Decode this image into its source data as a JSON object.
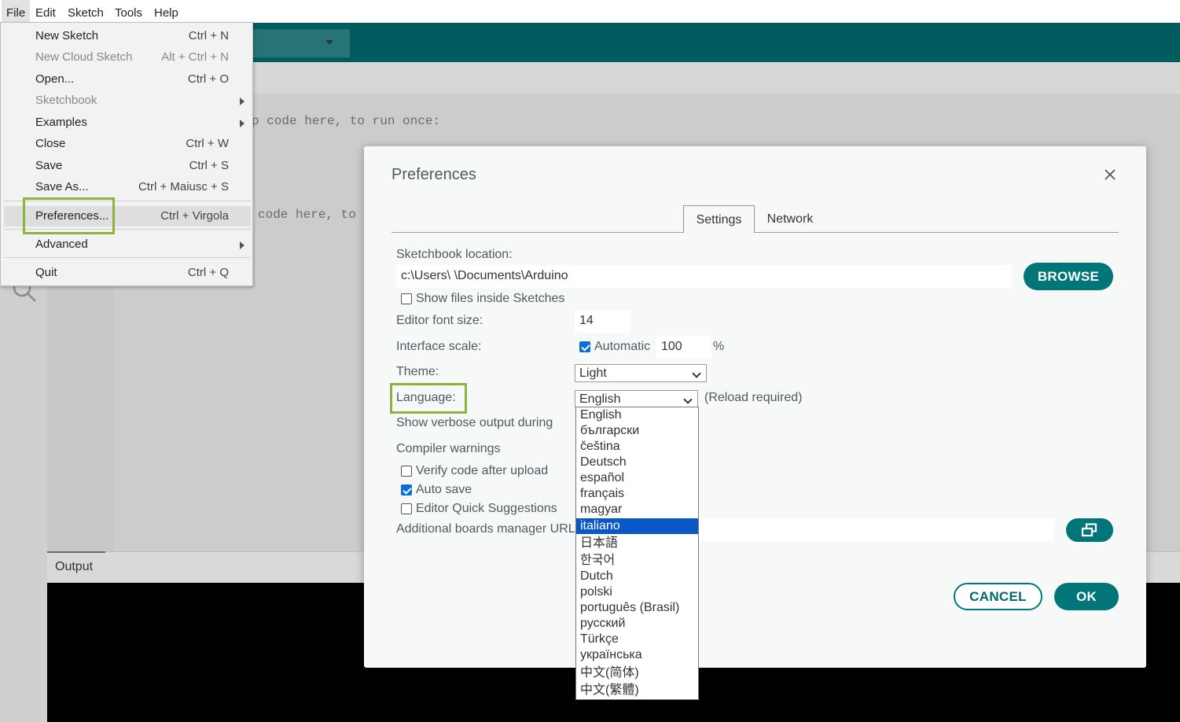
{
  "menubar": [
    "File",
    "Edit",
    "Sketch",
    "Tools",
    "Help"
  ],
  "editor": {
    "line1": "p code here, to run once:",
    "line2": "code here, to"
  },
  "output": {
    "label": "Output"
  },
  "file_menu": {
    "items": [
      {
        "label": "New Sketch",
        "shortcut": "Ctrl + N"
      },
      {
        "label": "New Cloud Sketch",
        "shortcut": "Alt + Ctrl + N"
      },
      {
        "label": "Open...",
        "shortcut": "Ctrl + O"
      },
      {
        "label": "Sketchbook",
        "shortcut": ""
      },
      {
        "label": "Examples",
        "shortcut": ""
      },
      {
        "label": "Close",
        "shortcut": "Ctrl + W"
      },
      {
        "label": "Save",
        "shortcut": "Ctrl + S"
      },
      {
        "label": "Save As...",
        "shortcut": "Ctrl + Maiusc + S"
      },
      {
        "label": "Preferences...",
        "shortcut": "Ctrl + Virgola"
      },
      {
        "label": "Advanced",
        "shortcut": ""
      },
      {
        "label": "Quit",
        "shortcut": "Ctrl + Q"
      }
    ]
  },
  "dialog": {
    "title": "Preferences",
    "tabs": {
      "settings": "Settings",
      "network": "Network"
    },
    "sketchbook_label": "Sketchbook location:",
    "sketchbook_path": "c:\\Users\\                \\Documents\\Arduino",
    "browse": "BROWSE",
    "show_files": "Show files inside Sketches",
    "font_size_label": "Editor font size:",
    "font_size": "14",
    "scale_label": "Interface scale:",
    "automatic": "Automatic",
    "scale_value": "100",
    "percent": "%",
    "theme_label": "Theme:",
    "theme_value": "Light",
    "language_label": "Language:",
    "language_value": "English",
    "reload_required": "(Reload required)",
    "verbose_label": "Show verbose output during",
    "compiler_label": "Compiler warnings",
    "verify": "Verify code after upload",
    "auto_save": "Auto save",
    "quick_suggestions": "Editor Quick Suggestions",
    "boards_label": "Additional boards manager URL",
    "cancel": "CANCEL",
    "ok": "OK"
  },
  "languages": [
    "English",
    "български",
    "čeština",
    "Deutsch",
    "español",
    "français",
    "magyar",
    "italiano",
    "日本語",
    "한국어",
    "Dutch",
    "polski",
    "português (Brasil)",
    "русский",
    "Türkçe",
    "українська",
    "中文(简体)",
    "中文(繁體)"
  ],
  "selected_language": "italiano",
  "colors": {
    "toolbar": "#005c5f",
    "accent": "#007679",
    "highlight": "#8db23e",
    "selection": "#0a58c7"
  }
}
